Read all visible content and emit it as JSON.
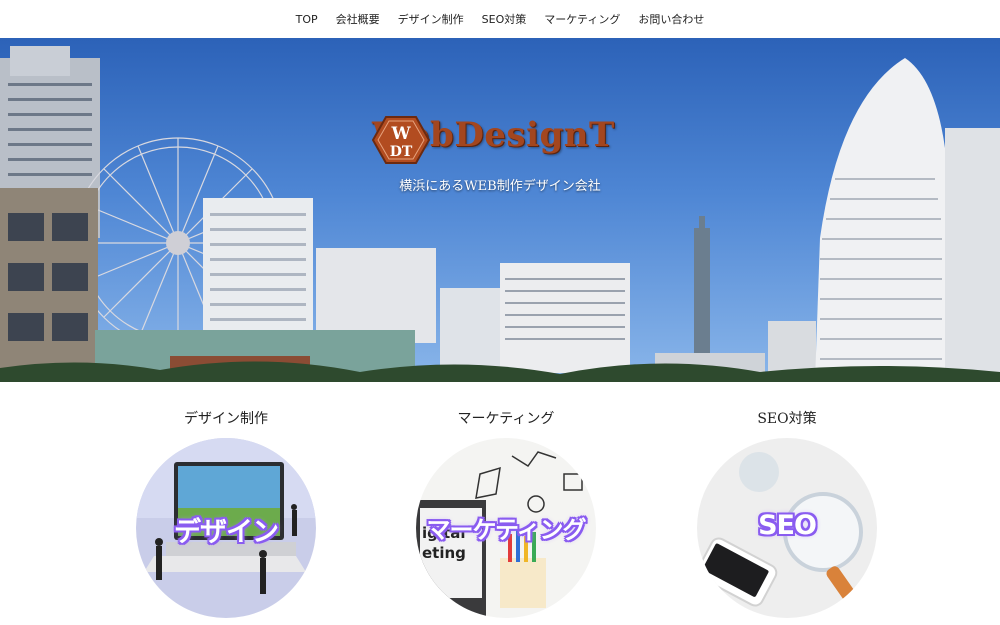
{
  "nav": {
    "items": [
      {
        "label": "TOP"
      },
      {
        "label": "会社概要"
      },
      {
        "label": "デザイン制作"
      },
      {
        "label": "SEO対策"
      },
      {
        "label": "マーケティング"
      },
      {
        "label": "お問い合わせ"
      }
    ]
  },
  "hero": {
    "logo_mark": "WDT",
    "logo_text": "WebDesignT",
    "tagline": "横浜にあるWEB制作デザイン会社"
  },
  "services": [
    {
      "title": "デザイン制作",
      "image_label": "デザイン"
    },
    {
      "title": "マーケティング",
      "image_label": "マーケティング"
    },
    {
      "title": "SEO対策",
      "image_label": "SEO"
    }
  ],
  "colors": {
    "sky": "#3f76c8",
    "logo_brown": "#a3461f",
    "label_outline": "#8a5cf0"
  }
}
